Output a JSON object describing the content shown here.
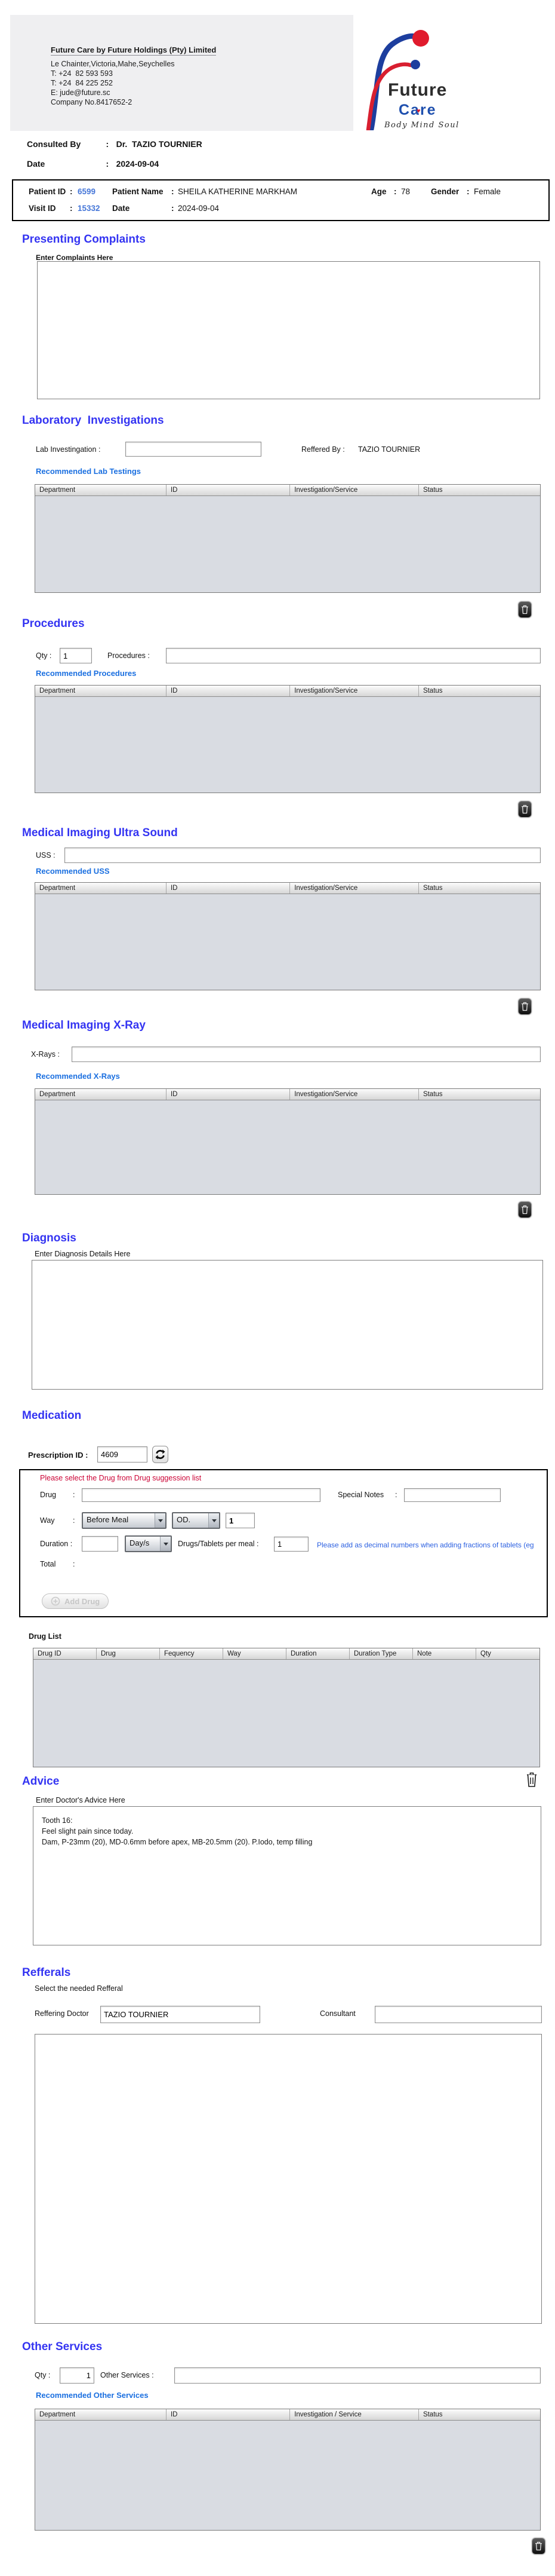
{
  "ui": {
    "colon": ":"
  },
  "company": {
    "title": "Future Care by Future Holdings (Pty) Limited",
    "address": "Le Chainter,Victoria,Mahe,Seychelles",
    "phone1": "T: +24  82 593 593",
    "phone2": "T: +24  84 225 252",
    "email": "E: jude@future.sc",
    "company_no": "Company No.8417652-2"
  },
  "logo": {
    "name": "Future",
    "name2": "Care",
    "tagline": "Body Mind Soul"
  },
  "consult": {
    "consulted_by_label": "Consulted By",
    "consulted_by_value": "Dr.  TAZIO TOURNIER",
    "date_label": "Date",
    "date_value": "2024-09-04"
  },
  "patient": {
    "patient_id_label": "Patient ID",
    "patient_id": "6599",
    "patient_name_label": "Patient Name",
    "patient_name": "SHEILA KATHERINE MARKHAM",
    "age_label": "Age",
    "age": "78",
    "gender_label": "Gender",
    "gender": "Female",
    "visit_id_label": "Visit ID",
    "visit_id": "15332",
    "date_label": "Date",
    "date": "2024-09-04"
  },
  "complaints": {
    "title": "Presenting Complaints",
    "hint": "Enter Complaints Here",
    "value": ""
  },
  "lab": {
    "title": "Laboratory  Investigations",
    "input_label": "Lab Investingation :",
    "input_value": "",
    "reffered_label": "Reffered By :",
    "reffered_value": "TAZIO TOURNIER",
    "link": "Recommended Lab Testings",
    "cols": [
      "Department",
      "ID",
      "Investigation/Service",
      "Status"
    ]
  },
  "procedures": {
    "title": "Procedures",
    "qty_label": "Qty :",
    "qty_value": "1",
    "input_label": "Procedures :",
    "input_value": "",
    "link": "Recommended Procedures",
    "cols": [
      "Department",
      "ID",
      "Investigation/Service",
      "Status"
    ]
  },
  "uss": {
    "title": "Medical Imaging Ultra Sound",
    "input_label": "USS :",
    "input_value": "",
    "link": "Recommended USS",
    "cols": [
      "Department",
      "ID",
      "Investigation/Service",
      "Status"
    ]
  },
  "xray": {
    "title": "Medical Imaging X-Ray",
    "input_label": "X-Rays :",
    "input_value": "",
    "link": "Recommended X-Rays",
    "cols": [
      "Department",
      "ID",
      "Investigation/Service",
      "Status"
    ]
  },
  "diagnosis": {
    "title": "Diagnosis",
    "hint": "Enter Diagnosis Details Here",
    "value": ""
  },
  "medication": {
    "title": "Medication",
    "prescription_label": "Prescription ID :",
    "prescription_id": "4609",
    "red_note": "Please select the Drug from Drug suggession list",
    "drug_label": "Drug",
    "drug_value": "",
    "special_notes_label": "Special Notes",
    "special_notes_value": "",
    "way_label": "Way",
    "way_value": "Before Meal",
    "frequency_value": "OD.",
    "way_qty": "1",
    "duration_label": "Duration :",
    "duration_value": "",
    "duration_unit": "Day/s",
    "per_meal_label": "Drugs/Tablets per meal :",
    "per_meal_value": "1",
    "blue_note": "Please add as decimal numbers when adding fractions of tablets (eg",
    "total_label": "Total",
    "add_drug_label": "Add Drug",
    "drug_list_label": "Drug List",
    "drug_cols": [
      "Drug ID",
      "Drug",
      "Fequency",
      "Way",
      "Duration",
      "Duration Type",
      "Note",
      "Qty"
    ]
  },
  "advice": {
    "title": "Advice",
    "hint": "Enter Doctor's Advice Here",
    "lines": [
      "Tooth 16:",
      "Feel slight pain since today.",
      "Dam, P-23mm (20), MD-0.6mm before apex, MB-20.5mm (20). P.Iodo, temp filling"
    ]
  },
  "refferals": {
    "title": "Refferals",
    "hint": "Select the needed Refferal",
    "doctor_label": "Reffering Doctor",
    "doctor_value": "TAZIO TOURNIER",
    "consultant_label": "Consultant",
    "consultant_value": ""
  },
  "other": {
    "title": "Other Services",
    "qty_label": "Qty :",
    "qty_value": "1",
    "input_label": "Other Services :",
    "input_value": "",
    "link": "Recommended Other Services",
    "cols": [
      "Department",
      "ID",
      "Investigation / Service",
      "Status"
    ]
  }
}
